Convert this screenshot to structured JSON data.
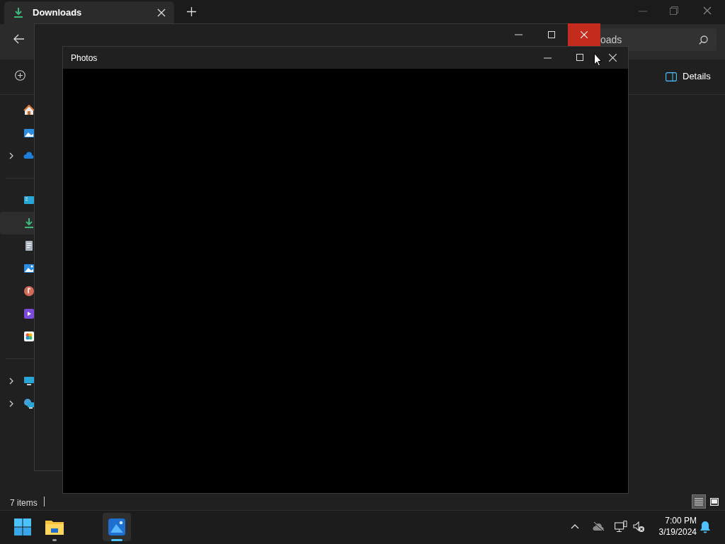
{
  "explorer": {
    "tab": {
      "title": "Downloads"
    },
    "search": {
      "value": "oads"
    },
    "command_bar": {
      "details": "Details"
    },
    "sidebar": {
      "sections": [
        {
          "items": [
            {
              "kind": "home",
              "expandable": false,
              "selected": false
            },
            {
              "kind": "gallery",
              "expandable": false,
              "selected": false
            },
            {
              "kind": "cloud",
              "expandable": true,
              "selected": false
            }
          ]
        },
        {
          "items": [
            {
              "kind": "desktop",
              "expandable": false,
              "selected": false
            },
            {
              "kind": "downloads",
              "expandable": false,
              "selected": true
            },
            {
              "kind": "documents",
              "expandable": false,
              "selected": false
            },
            {
              "kind": "pictures",
              "expandable": false,
              "selected": false
            },
            {
              "kind": "music",
              "expandable": false,
              "selected": false
            },
            {
              "kind": "videos",
              "expandable": false,
              "selected": false
            },
            {
              "kind": "photos",
              "expandable": false,
              "selected": false
            }
          ]
        },
        {
          "items": [
            {
              "kind": "pc",
              "expandable": true,
              "selected": false
            },
            {
              "kind": "network",
              "expandable": true,
              "selected": false
            }
          ]
        }
      ]
    },
    "status_bar": {
      "count": "7 items"
    },
    "view_buttons": [
      {
        "kind": "details",
        "selected": true
      },
      {
        "kind": "tiles",
        "selected": false
      }
    ]
  },
  "photos_window": {
    "title": "Photos"
  },
  "taskbar": {
    "apps": [
      {
        "kind": "explorer",
        "active": false
      },
      {
        "kind": "photos",
        "active": true
      }
    ],
    "clock": {
      "time": "7:00 PM",
      "date": "3/19/2024"
    }
  }
}
